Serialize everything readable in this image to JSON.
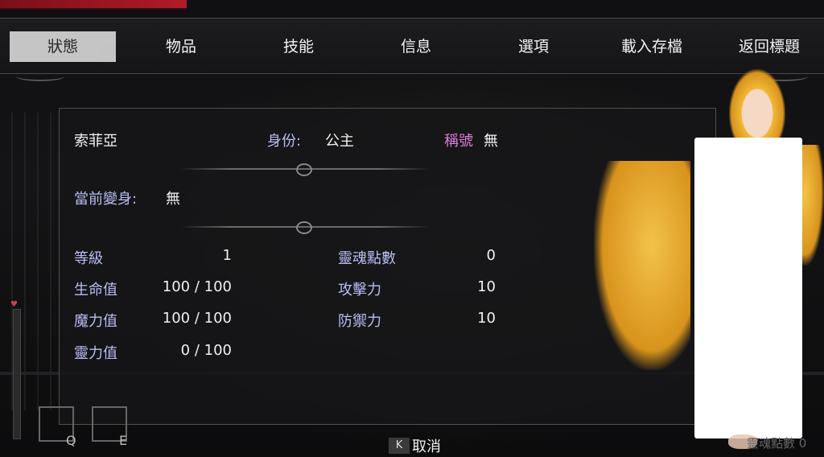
{
  "menu": {
    "tabs": [
      {
        "label": "狀態",
        "active": true
      },
      {
        "label": "物品"
      },
      {
        "label": "技能"
      },
      {
        "label": "信息"
      },
      {
        "label": "選項"
      },
      {
        "label": "載入存檔"
      },
      {
        "label": "返回標題"
      }
    ]
  },
  "status": {
    "name": "索菲亞",
    "identity_label": "身份:",
    "identity_value": "公主",
    "title_label": "稱號",
    "title_value": "無",
    "transform_label": "當前變身:",
    "transform_value": "無",
    "stats_left": [
      {
        "label": "等級",
        "value": "1"
      },
      {
        "label": "生命值",
        "value": "100 / 100"
      },
      {
        "label": "魔力值",
        "value": "100 / 100"
      },
      {
        "label": "靈力值",
        "value": "0 / 100"
      }
    ],
    "stats_right": [
      {
        "label": "靈魂點數",
        "value": "0"
      },
      {
        "label": "攻擊力",
        "value": "10"
      },
      {
        "label": "防禦力",
        "value": "10"
      }
    ]
  },
  "bottom": {
    "q_key": "Q",
    "e_key": "E",
    "cancel_key": "K",
    "cancel_label": "取消",
    "faded_label": "靈魂點數 0"
  },
  "colors": {
    "label_blue": "#b9bdf5",
    "title_pink": "#e07ad9",
    "hp_red": "#b01c28"
  }
}
